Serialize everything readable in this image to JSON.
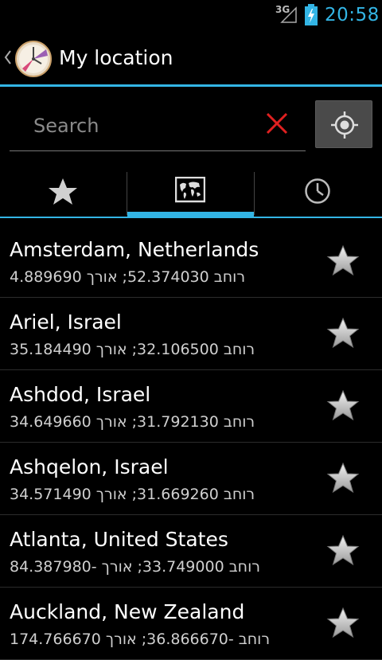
{
  "status_bar": {
    "network": "3G",
    "time": "20:58",
    "accent_color": "#33b5e5"
  },
  "action_bar": {
    "title": "My location",
    "app_icon": "clock-icon",
    "up_icon": "chevron-left-icon"
  },
  "search": {
    "placeholder": "Search",
    "value": "",
    "clear_icon": "close-icon",
    "locate_icon": "gps-target-icon"
  },
  "tabs": [
    {
      "icon": "star-icon",
      "selected": false
    },
    {
      "icon": "world-map-icon",
      "selected": true
    },
    {
      "icon": "clock-icon",
      "selected": false
    }
  ],
  "locations": [
    {
      "name": "Amsterdam, Netherlands",
      "coords": "רוחב 52.374030; אורך 4.889690",
      "favorite": false
    },
    {
      "name": "Ariel, Israel",
      "coords": "רוחב 32.106500; אורך 35.184490",
      "favorite": false
    },
    {
      "name": "Ashdod, Israel",
      "coords": "רוחב 31.792130; אורך 34.649660",
      "favorite": false
    },
    {
      "name": "Ashqelon, Israel",
      "coords": "רוחב 31.669260; אורך 34.571490",
      "favorite": false
    },
    {
      "name": "Atlanta, United States",
      "coords": "רוחב 33.749000; אורך -84.387980",
      "favorite": false
    },
    {
      "name": "Auckland, New Zealand",
      "coords": "רוחב -36.866670; אורך 174.766670",
      "favorite": false
    }
  ]
}
